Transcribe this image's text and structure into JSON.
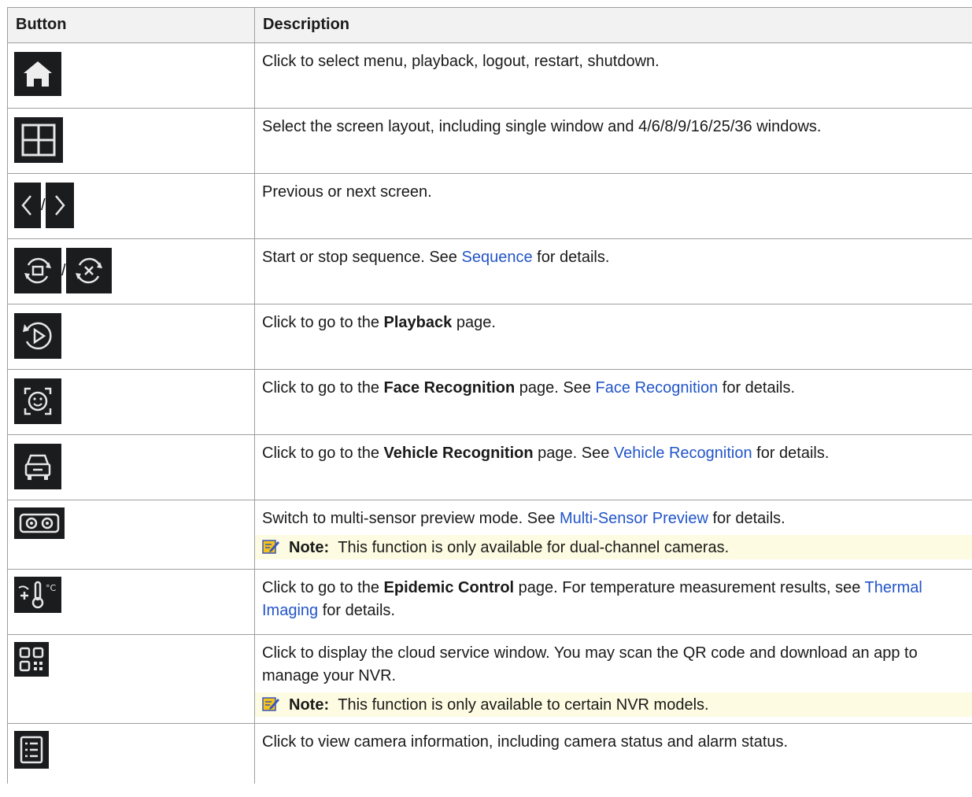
{
  "table": {
    "headers": {
      "button": "Button",
      "description": "Description"
    },
    "rows": [
      {
        "icons": [
          "home-icon"
        ],
        "text": "Click to select menu, playback, logout, restart, shutdown."
      },
      {
        "icons": [
          "grid-layout-icon"
        ],
        "text": "Select the screen layout, including single window and 4/6/8/9/16/25/36 windows."
      },
      {
        "icons": [
          "chevron-left-icon",
          "chevron-right-icon"
        ],
        "separator": "/",
        "text": "Previous or next screen."
      },
      {
        "icons": [
          "sequence-start-icon",
          "sequence-stop-icon"
        ],
        "separator": "/",
        "pre": "Start or stop sequence. See ",
        "link": "Sequence",
        "post": " for details."
      },
      {
        "icons": [
          "playback-icon"
        ],
        "pre": "Click to go to the ",
        "bold": "Playback",
        "post": " page."
      },
      {
        "icons": [
          "face-recognition-icon"
        ],
        "pre": "Click to go to the ",
        "bold": "Face Recognition",
        "mid": " page. See ",
        "link": "Face Recognition",
        "post": " for details."
      },
      {
        "icons": [
          "vehicle-recognition-icon"
        ],
        "pre": "Click to go to the ",
        "bold": "Vehicle Recognition",
        "mid": " page. See ",
        "link": "Vehicle Recognition",
        "post": " for details."
      },
      {
        "icons": [
          "multi-sensor-icon"
        ],
        "pre": "Switch to multi-sensor preview mode. See ",
        "link": "Multi-Sensor Preview",
        "post": " for details.",
        "note_label": "Note:",
        "note_text": "This function is only available for dual-channel cameras."
      },
      {
        "icons": [
          "epidemic-control-icon"
        ],
        "pre": "Click to go to the ",
        "bold": "Epidemic Control",
        "mid": " page. For temperature measurement results, see ",
        "link": "Thermal Imaging",
        "post": " for details."
      },
      {
        "icons": [
          "qr-code-icon"
        ],
        "text": "Click to display the cloud service window. You may scan the QR code and download an app to manage your NVR.",
        "note_label": "Note:",
        "note_text": "This function is only available to certain NVR models."
      },
      {
        "icons": [
          "camera-info-list-icon"
        ],
        "text": "Click to view camera information, including camera status and alarm status."
      }
    ]
  },
  "colors": {
    "link": "#2255c8",
    "note_bg": "#fdfbe1",
    "header_bg": "#f2f2f2",
    "icon_bg": "#1b1c1e"
  }
}
